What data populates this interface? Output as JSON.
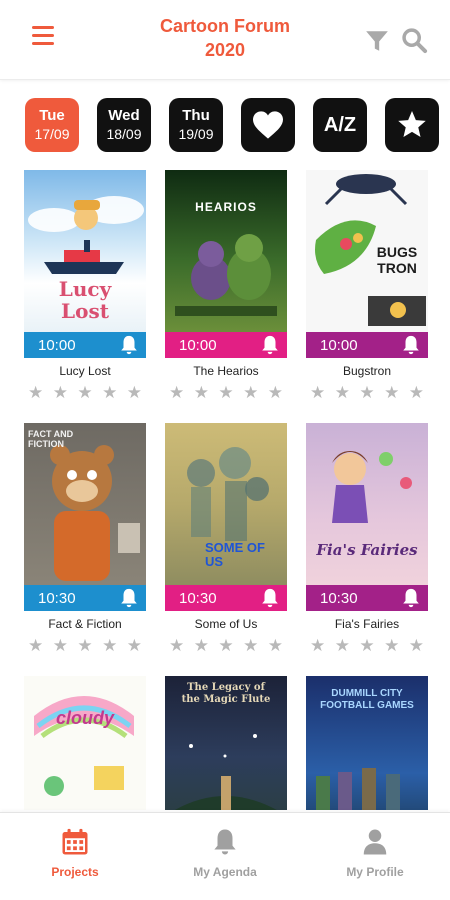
{
  "app": {
    "title_line1": "Cartoon Forum",
    "title_line2": "2020"
  },
  "days": [
    {
      "day": "Tue",
      "date": "17/09",
      "active": true
    },
    {
      "day": "Wed",
      "date": "18/09",
      "active": false
    },
    {
      "day": "Thu",
      "date": "19/09",
      "active": false
    }
  ],
  "filters": {
    "az_label": "A/Z"
  },
  "projects": [
    {
      "title": "Lucy Lost",
      "time": "10:00",
      "rating": 0,
      "poster_text": "Lucy Lost"
    },
    {
      "title": "The Hearios",
      "time": "10:00",
      "rating": 0,
      "poster_text": "HEARIOS"
    },
    {
      "title": "Bugstron",
      "time": "10:00",
      "rating": 0,
      "poster_text": "BUGS TRON"
    },
    {
      "title": "Fact & Fiction",
      "time": "10:30",
      "rating": 0,
      "poster_text": "FACT AND FICTION"
    },
    {
      "title": "Some of Us",
      "time": "10:30",
      "rating": 0,
      "poster_text": "SOME OF US"
    },
    {
      "title": "Fia's Fairies",
      "time": "10:30",
      "rating": 0,
      "poster_text": "Fia's Fairies"
    },
    {
      "title": "",
      "time": "",
      "rating": 0,
      "poster_text": "cloudy"
    },
    {
      "title": "",
      "time": "",
      "rating": 0,
      "poster_text": "The Legacy of the Magic Flute"
    },
    {
      "title": "",
      "time": "",
      "rating": 0,
      "poster_text": "DUMMILL CITY FOOTBALL GAMES"
    }
  ],
  "nav": [
    {
      "label": "Projects",
      "icon": "calendar-icon",
      "active": true
    },
    {
      "label": "My Agenda",
      "icon": "bell-icon",
      "active": false
    },
    {
      "label": "My Profile",
      "icon": "person-icon",
      "active": false
    }
  ],
  "colors": {
    "accent": "#ef5a3c",
    "time_blue": "#1d8fce",
    "time_pink": "#e21f84",
    "time_purple": "#a32188",
    "chip_dark": "#111111",
    "star_inactive": "#b9b9b9"
  }
}
